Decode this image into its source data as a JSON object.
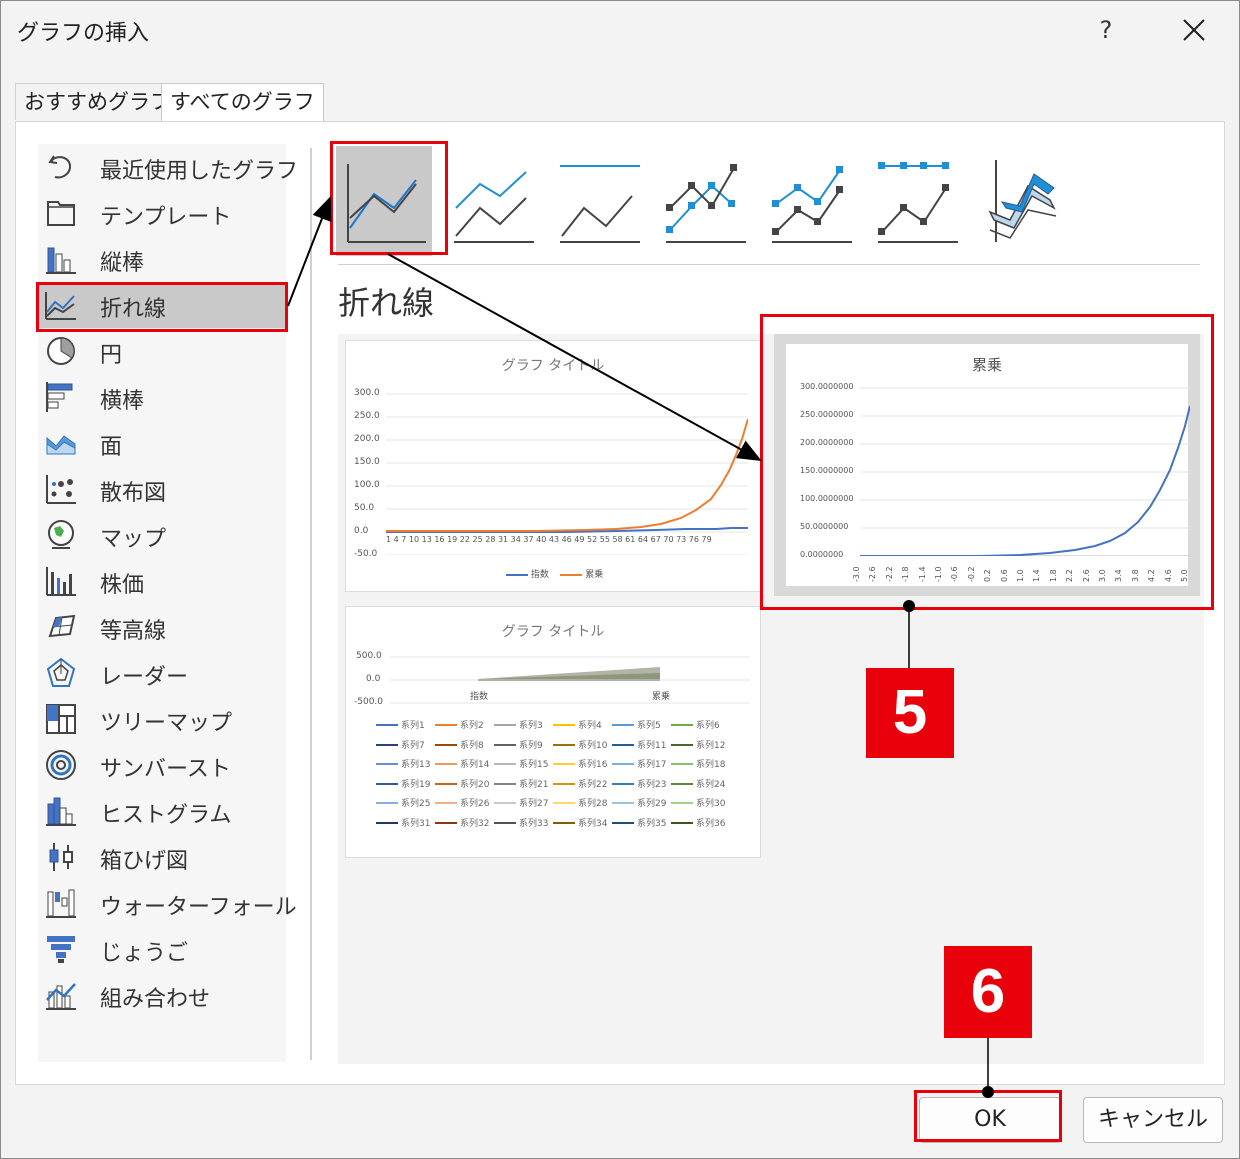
{
  "dialog": {
    "title": "グラフの挿入",
    "help": "?"
  },
  "tabs": [
    {
      "label": "おすすめグラフ"
    },
    {
      "label": "すべてのグラフ"
    }
  ],
  "chart_types": [
    {
      "label": "最近使用したグラフ",
      "icon": "recent-icon"
    },
    {
      "label": "テンプレート",
      "icon": "folder-icon"
    },
    {
      "label": "縦棒",
      "icon": "column-chart-icon"
    },
    {
      "label": "折れ線",
      "icon": "line-chart-icon",
      "selected": true
    },
    {
      "label": "円",
      "icon": "pie-chart-icon"
    },
    {
      "label": "横棒",
      "icon": "bar-chart-icon"
    },
    {
      "label": "面",
      "icon": "area-chart-icon"
    },
    {
      "label": "散布図",
      "icon": "scatter-chart-icon"
    },
    {
      "label": "マップ",
      "icon": "map-chart-icon"
    },
    {
      "label": "株価",
      "icon": "stock-chart-icon"
    },
    {
      "label": "等高線",
      "icon": "surface-chart-icon"
    },
    {
      "label": "レーダー",
      "icon": "radar-chart-icon"
    },
    {
      "label": "ツリーマップ",
      "icon": "treemap-chart-icon"
    },
    {
      "label": "サンバースト",
      "icon": "sunburst-chart-icon"
    },
    {
      "label": "ヒストグラム",
      "icon": "histogram-chart-icon"
    },
    {
      "label": "箱ひげ図",
      "icon": "box-whisker-chart-icon"
    },
    {
      "label": "ウォーターフォール",
      "icon": "waterfall-chart-icon"
    },
    {
      "label": "じょうご",
      "icon": "funnel-chart-icon"
    },
    {
      "label": "組み合わせ",
      "icon": "combo-chart-icon"
    }
  ],
  "section_title": "折れ線",
  "previews": {
    "p1": {
      "title": "グラフ タイトル",
      "yticks": [
        "300.0",
        "250.0",
        "200.0",
        "150.0",
        "100.0",
        "50.0",
        "0.0",
        "-50.0"
      ],
      "xticks": "1  4  7 10 13 16 19 22 25 28 31 34 37 40 43 46 49 52 55 58 61 64 67 70 73 76 79",
      "legend": [
        "指数",
        "累乗"
      ]
    },
    "p2": {
      "title": "累乗",
      "yticks": [
        "300.0000000",
        "250.0000000",
        "200.0000000",
        "150.0000000",
        "100.0000000",
        "50.0000000",
        "0.0000000"
      ],
      "xticks": [
        "-3.0",
        "-2.6",
        "-2.2",
        "-1.8",
        "-1.4",
        "-1.0",
        "-0.6",
        "-0.2",
        "0.2",
        "0.6",
        "1.0",
        "1.4",
        "1.8",
        "2.2",
        "2.6",
        "3.0",
        "3.4",
        "3.8",
        "4.2",
        "4.6",
        "5.0"
      ]
    },
    "p3": {
      "title": "グラフ タイトル",
      "yticks": [
        "500.0",
        "0.0",
        "-500.0"
      ],
      "xcats": [
        "指数",
        "累乗"
      ],
      "series": [
        "系列1",
        "系列2",
        "系列3",
        "系列4",
        "系列5",
        "系列6",
        "系列7",
        "系列8",
        "系列9",
        "系列10",
        "系列11",
        "系列12",
        "系列13",
        "系列14",
        "系列15",
        "系列16",
        "系列17",
        "系列18",
        "系列19",
        "系列20",
        "系列21",
        "系列22",
        "系列23",
        "系列24",
        "系列25",
        "系列26",
        "系列27",
        "系列28",
        "系列29",
        "系列30",
        "系列31",
        "系列32",
        "系列33",
        "系列34",
        "系列35",
        "系列36"
      ]
    }
  },
  "markers": {
    "m5": "5",
    "m6": "6"
  },
  "buttons": {
    "ok": "OK",
    "cancel": "キャンセル"
  },
  "colors": {
    "highlight": "#e8000b",
    "blue": "#4472c4",
    "orange": "#ed7d31",
    "accent": "#1e90d6"
  }
}
